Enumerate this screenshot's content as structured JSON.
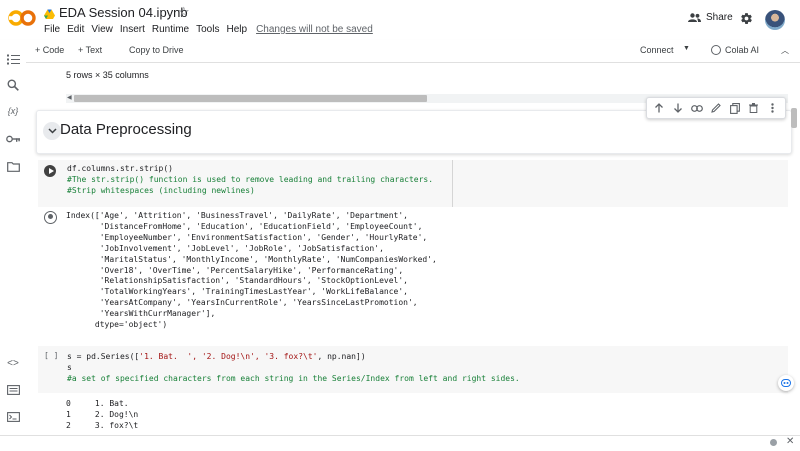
{
  "header": {
    "logo": "CO",
    "doc_title": "EDA Session 04.ipynb",
    "star_icon": "star-icon",
    "menu": [
      "File",
      "Edit",
      "View",
      "Insert",
      "Runtime",
      "Tools",
      "Help"
    ],
    "unsaved_notice": "Changes will not be saved",
    "share_label": "Share"
  },
  "toolbar": {
    "add_code": "+ Code",
    "add_text": "+ Text",
    "copy_to_drive": "Copy to Drive",
    "connect": "Connect",
    "colab_ai": "Colab AI"
  },
  "notebook": {
    "rows_info": "5 rows × 35 columns",
    "section_title": "Data Preprocessing",
    "cell1": {
      "line1": "df.columns.str.strip()",
      "comment1": "#The str.strip() function is used to remove leading and trailing characters.",
      "comment2": "#Strip whitespaces (including newlines)"
    },
    "output1": "Index(['Age', 'Attrition', 'BusinessTravel', 'DailyRate', 'Department',\n       'DistanceFromHome', 'Education', 'EducationField', 'EmployeeCount',\n       'EmployeeNumber', 'EnvironmentSatisfaction', 'Gender', 'HourlyRate',\n       'JobInvolvement', 'JobLevel', 'JobRole', 'JobSatisfaction',\n       'MaritalStatus', 'MonthlyIncome', 'MonthlyRate', 'NumCompaniesWorked',\n       'Over18', 'OverTime', 'PercentSalaryHike', 'PerformanceRating',\n       'RelationshipSatisfaction', 'StandardHours', 'StockOptionLevel',\n       'TotalWorkingYears', 'TrainingTimesLastYear', 'WorkLifeBalance',\n       'YearsAtCompany', 'YearsInCurrentRole', 'YearsSinceLastPromotion',\n       'YearsWithCurrManager'],\n      dtype='object')",
    "cell2": {
      "prompt": "[ ]",
      "line1_pre": "s = pd.Series([",
      "line1_str": "'1. Bat.  ', '2. Dog!\\n', '3. fox?\\t'",
      "line1_post": ", np.nan])",
      "line2": "s",
      "comment": "#a set of specified characters from each string in the Series/Index from left and right sides."
    },
    "output2": "0     1. Bat.\n1     2. Dog!\\n\n2     3. fox?\\t"
  }
}
